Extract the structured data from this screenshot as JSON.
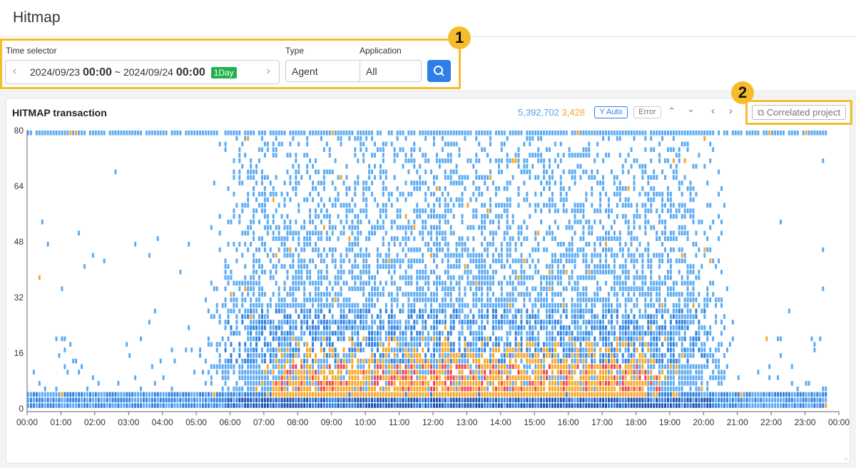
{
  "page": {
    "title": "Hitmap"
  },
  "filters": {
    "time_label": "Time selector",
    "start_date": "2024/09/23",
    "start_time": "00:00",
    "tilde": "~",
    "end_date": "2024/09/24",
    "end_time": "00:00",
    "range_badge": "1Day",
    "type_label": "Type",
    "type_value": "Agent",
    "app_label": "Application",
    "app_value": "All"
  },
  "callouts": [
    "1",
    "2"
  ],
  "chart": {
    "title": "HITMAP transaction",
    "total_count": "5,392,702",
    "error_count": "3,428",
    "y_auto_label": "Y Auto",
    "error_label": "Error",
    "correlated_label": "Correlated project"
  },
  "colors": {
    "accent": "#2f7fe8",
    "normal_light": "#5aaaf3",
    "normal_mid": "#2e80df",
    "normal_dark": "#1a4fae",
    "slow": "#f7a625",
    "error": "#ef4252",
    "badge": "#1fb14c",
    "highlight": "#f6bd2b"
  },
  "chart_data": {
    "type": "heatmap",
    "title": "HITMAP transaction",
    "ylim": [
      0,
      80
    ],
    "yticks": [
      "0",
      "16",
      "32",
      "48",
      "64",
      "80"
    ],
    "xticks": [
      "00:00",
      "01:00",
      "02:00",
      "03:00",
      "04:00",
      "05:00",
      "06:00",
      "07:00",
      "08:00",
      "09:00",
      "10:00",
      "11:00",
      "12:00",
      "13:00",
      "14:00",
      "15:00",
      "16:00",
      "17:00",
      "18:00",
      "19:00",
      "20:00",
      "21:00",
      "22:00",
      "23:00",
      "00:00"
    ],
    "legend": [
      {
        "name": "5,392,702",
        "color": "#2e80df"
      },
      {
        "name": "3,428",
        "color": "#f7a625"
      }
    ]
  }
}
